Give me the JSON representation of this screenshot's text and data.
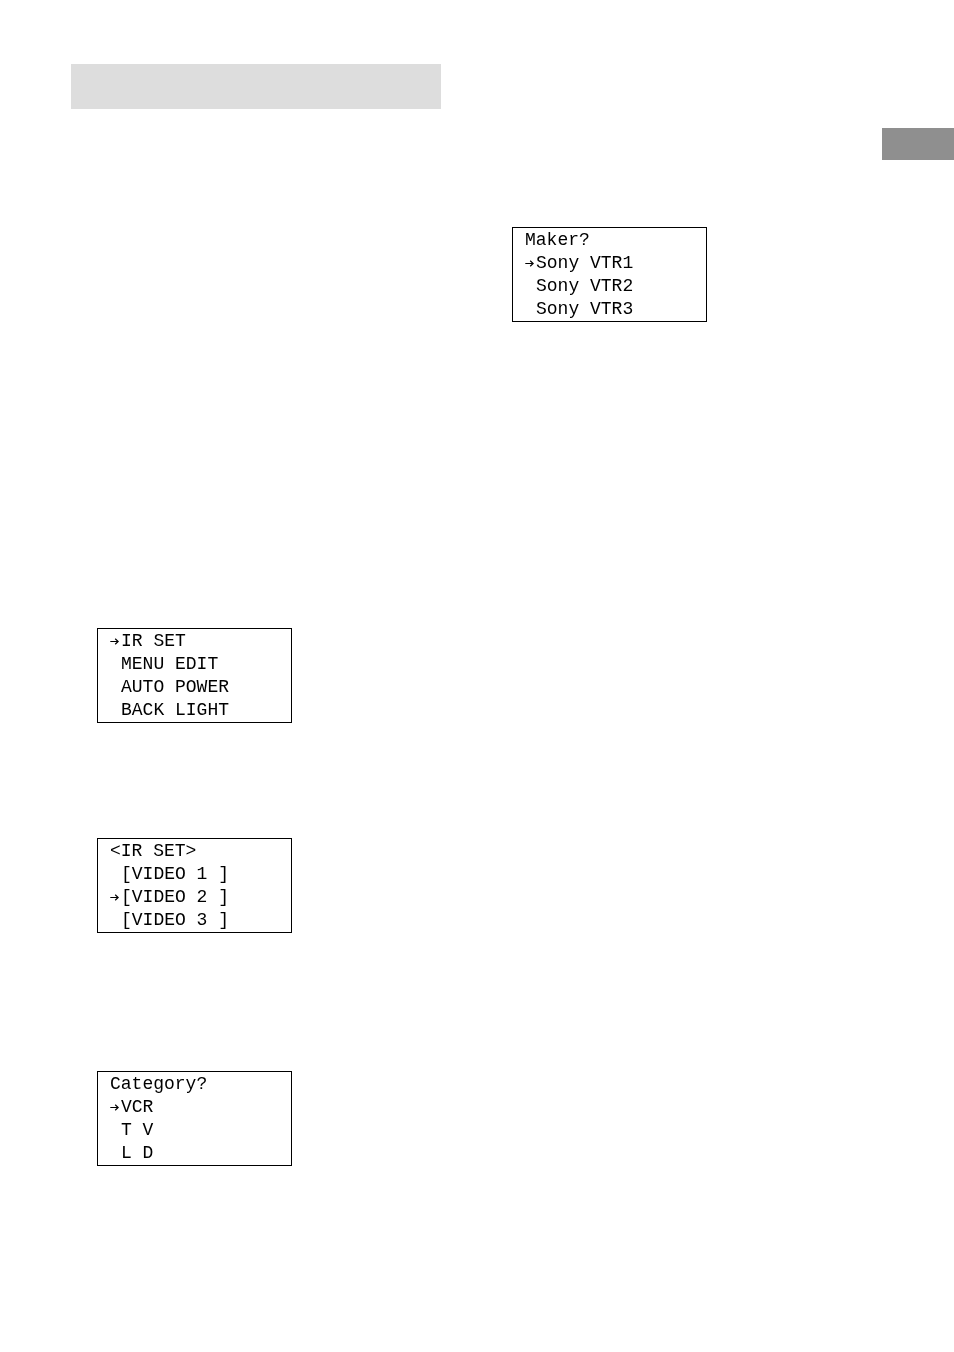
{
  "left_column": {
    "displays": [
      {
        "items": [
          {
            "label": "IR SET",
            "selected": true
          },
          {
            "label": "MENU EDIT",
            "selected": false
          },
          {
            "label": "AUTO POWER",
            "selected": false
          },
          {
            "label": "BACK LIGHT",
            "selected": false
          }
        ]
      },
      {
        "title": "<IR SET>",
        "items": [
          {
            "label": "[VIDEO 1 ]",
            "selected": false
          },
          {
            "label": "[VIDEO 2 ]",
            "selected": true
          },
          {
            "label": "[VIDEO 3 ]",
            "selected": false
          }
        ]
      },
      {
        "title": "Category?",
        "items": [
          {
            "label": "VCR",
            "selected": true
          },
          {
            "label": "T V",
            "selected": false
          },
          {
            "label": "L D",
            "selected": false
          }
        ]
      }
    ]
  },
  "right_column": {
    "displays": [
      {
        "title": "Maker?",
        "items": [
          {
            "label": "Sony VTR1",
            "selected": true
          },
          {
            "label": "Sony VTR2",
            "selected": false
          },
          {
            "label": "Sony VTR3",
            "selected": false
          }
        ]
      }
    ]
  }
}
